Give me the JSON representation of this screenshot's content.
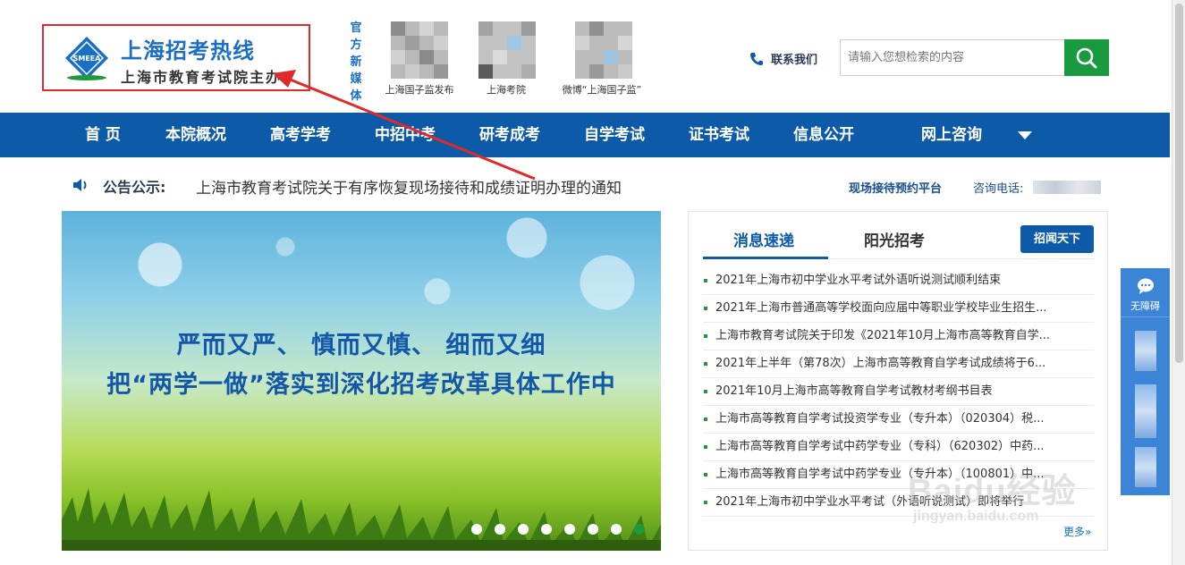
{
  "header": {
    "logo_emblem_text": "SMEEA",
    "site_title": "上海招考热线",
    "site_subtitle": "上海市教育考试院主办",
    "media_label": "官方新媒体",
    "qrcodes": [
      {
        "caption": "上海国子监发布"
      },
      {
        "caption": "上海考院"
      },
      {
        "caption": "微博“上海国子监”"
      }
    ],
    "contact_label": "联系我们",
    "search_placeholder": "请输入您想检索的内容"
  },
  "nav": {
    "items": [
      "首 页",
      "本院概况",
      "高考学考",
      "中招中考",
      "研考成考",
      "自学考试",
      "证书考试",
      "信息公开",
      "网上咨询"
    ]
  },
  "notice": {
    "label": "公告公示:",
    "text": "上海市教育考试院关于有序恢复现场接待和成绩证明办理的通知",
    "booking_link": "现场接待预约平台",
    "hotline_label": "咨询电话:"
  },
  "banner": {
    "line1": "严而又严、 慎而又慎、 细而又细",
    "line2": "把“两学一做”落实到深化招考改革具体工作中",
    "slide_count": 8,
    "active_slide": 8
  },
  "news": {
    "tab_active": "消息速递",
    "tab_other": "阳光招考",
    "button_label": "招闻天下",
    "items": [
      "2021年上海市初中学业水平考试外语听说测试顺利结束",
      "2021年上海市普通高等学校面向应届中等职业学校毕业生招生...",
      "上海市教育考试院关于印发《2021年10月上海市高等教育自学...",
      "2021年上半年（第78次）上海市高等教育自学考试成绩将于6...",
      "2021年10月上海市高等教育自学考试教材考纲书目表",
      "上海市高等教育自学考试投资学专业（专升本）（020304）税...",
      "上海市高等教育自学考试中药学专业（专科）（620302）中药...",
      "上海市高等教育自学考试中药学专业（专升本）（100801）中...",
      "2021年上海市初中学业水平考试（外语听说测试）即将举行"
    ],
    "more_label": "更多»"
  },
  "sidebar": {
    "chat_label": "无障碍"
  },
  "watermark": {
    "main": "Baidu经验",
    "url": "jingyan.baidu.com"
  },
  "colors": {
    "primary_blue": "#0c5aa8",
    "title_blue": "#1a6fc4",
    "search_green": "#1a9a3e",
    "annotation_red": "#e02a2a"
  }
}
